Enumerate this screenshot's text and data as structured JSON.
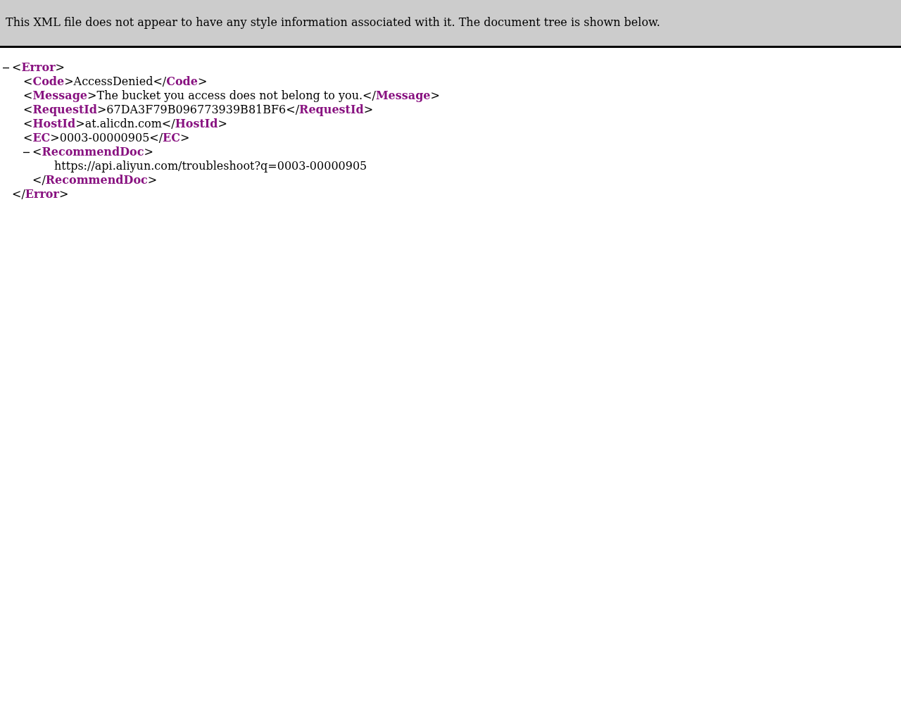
{
  "banner": "This XML file does not appear to have any style information associated with it. The document tree is shown below.",
  "syntax": {
    "open": "<",
    "close_open": "</",
    "end": ">"
  },
  "tree": {
    "tag": "Error",
    "close_tag": "Error",
    "expanded": true,
    "children": [
      {
        "tag": "Code",
        "text": "AccessDenied",
        "close_tag": "Code"
      },
      {
        "tag": "Message",
        "text": "The bucket you access does not belong to you.",
        "close_tag": "Message"
      },
      {
        "tag": "RequestId",
        "text": "67DA3F79B096773939B81BF6",
        "close_tag": "RequestId"
      },
      {
        "tag": "HostId",
        "text": "at.alicdn.com",
        "close_tag": "HostId"
      },
      {
        "tag": "EC",
        "text": "0003-00000905",
        "close_tag": "EC"
      },
      {
        "tag": "RecommendDoc",
        "close_tag": "RecommendDoc",
        "expanded": true,
        "children": [
          {
            "text": "https://api.aliyun.com/troubleshoot?q=0003-00000905"
          }
        ]
      }
    ]
  }
}
